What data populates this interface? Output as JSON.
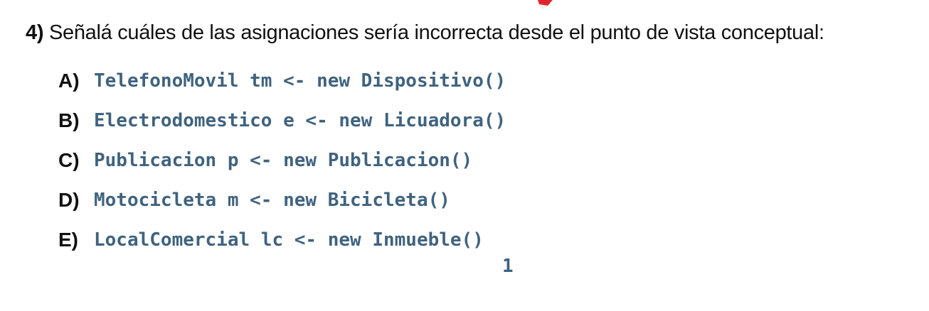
{
  "question": {
    "number": "4)",
    "text": " Señalá cuáles de las asignaciones sería incorrecta desde el punto de vista conceptual:"
  },
  "options": [
    {
      "letter": "A)",
      "code": "TelefonoMovil tm <- new Dispositivo()"
    },
    {
      "letter": "B)",
      "code": "Electrodomestico e <- new Licuadora()"
    },
    {
      "letter": "C)",
      "code": "Publicacion p <- new Publicacion()"
    },
    {
      "letter": "D)",
      "code": "Motocicleta m <- new Bicicleta()"
    },
    {
      "letter": "E)",
      "code": "LocalComercial lc <- new Inmueble()"
    }
  ],
  "page_number": "1",
  "colors": {
    "code": "#3f6380",
    "text": "#111111",
    "mark": "#e0242b"
  }
}
